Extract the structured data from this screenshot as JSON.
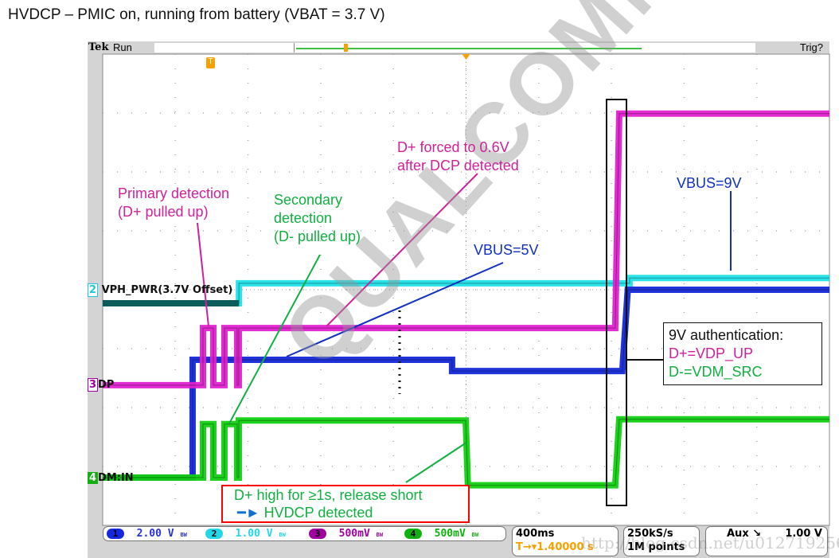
{
  "slide_title": "HVDCP – PMIC on, running from battery (VBAT = 3.7 V)",
  "scope": {
    "brand": "Tek",
    "state": "Run",
    "trigger_status": "Trig?",
    "trigger_marker": "T",
    "channels": [
      {
        "num": "1",
        "scale": "2.00 V",
        "bw": "BW",
        "color": "#1428e0"
      },
      {
        "num": "2",
        "scale": "1.00 V",
        "bw": "BW",
        "color": "#22d8e8"
      },
      {
        "num": "3",
        "scale": "500mV",
        "bw": "BW",
        "color": "#a000a0"
      },
      {
        "num": "4",
        "scale": "500mV",
        "bw": "BW",
        "color": "#10b010"
      }
    ],
    "timebase": "400ms",
    "trigger_position": "1.40000 s",
    "sample_rate": "250kS/s",
    "record_length": "1M points",
    "trigger_source": "Aux",
    "trigger_level": "1.00 V",
    "trace_labels": {
      "ch2": "VPH_PWR(3.7V Offset)",
      "ch3": "DP",
      "ch4": "DM:IN"
    }
  },
  "annotations": {
    "primary": [
      "Primary detection",
      "(D+ pulled up)"
    ],
    "secondary": [
      "Secondary",
      "detection",
      "(D- pulled up)"
    ],
    "forced": [
      "D+ forced to 0.6V",
      "after DCP detected"
    ],
    "vbus5": "VBUS=5V",
    "vbus9": "VBUS=9V",
    "auth": [
      "9V authentication:",
      "D+=VDP_UP",
      "D-=VDM_SRC"
    ],
    "hvdcp": [
      "D+ high for ≥1s, release short",
      "HVDCP detected"
    ]
  },
  "watermarks": {
    "logo": "QUALCOMM",
    "url": "http://blog.csdn.net/u012719256"
  },
  "colors": {
    "magenta": "#e020d0",
    "cyan": "#20e0e8",
    "blue": "#1428d8",
    "green": "#10d010",
    "annot_magenta": "#d0209a",
    "annot_green": "#10b040",
    "annot_blue": "#1030c0",
    "red_box": "#ff0000",
    "trigger_orange": "#f7a000"
  },
  "chart_data": {
    "type": "line",
    "x_unit": "s",
    "y_unit": "div",
    "xlim": [
      0,
      4
    ],
    "ylim": [
      -4,
      4
    ],
    "grid": true,
    "series": [
      {
        "name": "VPH_PWR(3.7V Offset)",
        "channel": "2",
        "points": [
          [
            0,
            -0.23
          ],
          [
            0.75,
            -0.23
          ],
          [
            0.75,
            0.11
          ],
          [
            2.9,
            0.11
          ],
          [
            2.9,
            0.2
          ],
          [
            4,
            0.2
          ]
        ]
      },
      {
        "name": "DP",
        "channel": "3",
        "points": [
          [
            0,
            -1.62
          ],
          [
            0.552,
            -1.62
          ],
          [
            0.552,
            -0.65
          ],
          [
            0.609,
            -0.65
          ],
          [
            0.609,
            -1.62
          ],
          [
            0.67,
            -1.62
          ],
          [
            0.67,
            -0.65
          ],
          [
            0.74,
            -0.65
          ],
          [
            0.74,
            -1.62
          ],
          [
            0.749,
            -1.62
          ],
          [
            0.749,
            -0.65
          ],
          [
            2.821,
            -0.65
          ],
          [
            2.843,
            2.99
          ],
          [
            4,
            2.99
          ]
        ]
      },
      {
        "channel": "1",
        "points": [
          [
            0,
            -3.19
          ],
          [
            0.495,
            -3.19
          ],
          [
            0.495,
            -1.19
          ],
          [
            1.923,
            -1.19
          ],
          [
            1.923,
            -1.38
          ],
          [
            2.86,
            -1.38
          ],
          [
            2.89,
            0
          ],
          [
            4,
            0
          ]
        ]
      },
      {
        "name": "DM:IN",
        "channel": "4",
        "points": [
          [
            0,
            -3.19
          ],
          [
            0.552,
            -3.19
          ],
          [
            0.552,
            -2.28
          ],
          [
            0.609,
            -2.28
          ],
          [
            0.609,
            -3.19
          ],
          [
            0.67,
            -3.19
          ],
          [
            0.67,
            -2.28
          ],
          [
            0.74,
            -2.28
          ],
          [
            0.74,
            -3.19
          ],
          [
            0.749,
            -3.19
          ],
          [
            0.749,
            -2.22
          ],
          [
            1.998,
            -2.22
          ],
          [
            2.01,
            -3.32
          ],
          [
            2.821,
            -3.32
          ],
          [
            2.843,
            -2.2
          ],
          [
            4,
            -2.2
          ]
        ]
      }
    ]
  }
}
